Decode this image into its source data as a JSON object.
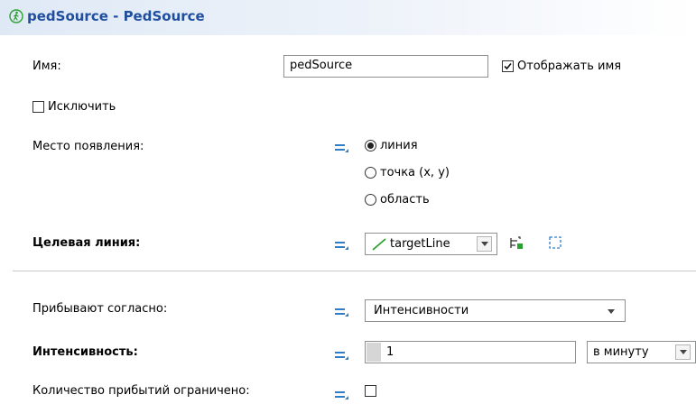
{
  "header": {
    "title": "pedSource - PedSource",
    "icon": "pedestrian-icon"
  },
  "name": {
    "label": "Имя:",
    "value": "pedSource",
    "show_name_label": "Отображать имя",
    "show_name_checked": true
  },
  "exclude": {
    "label": "Исключить",
    "checked": false
  },
  "location": {
    "label": "Место появления:",
    "options": [
      "линия",
      "точка (x, y)",
      "область"
    ],
    "selected": "линия"
  },
  "target_line": {
    "label": "Целевая линия:",
    "value": "targetLine"
  },
  "arrivals": {
    "label": "Прибывают согласно:",
    "value": "Интенсивности"
  },
  "rate": {
    "label": "Интенсивность:",
    "value": "1",
    "unit": "в минуту"
  },
  "limited": {
    "label": "Количество прибытий ограничено:",
    "checked": false
  },
  "colors": {
    "title": "#1f4e9e",
    "eq_icon": "#2f7ec9",
    "line_icon": "#2aa030"
  }
}
